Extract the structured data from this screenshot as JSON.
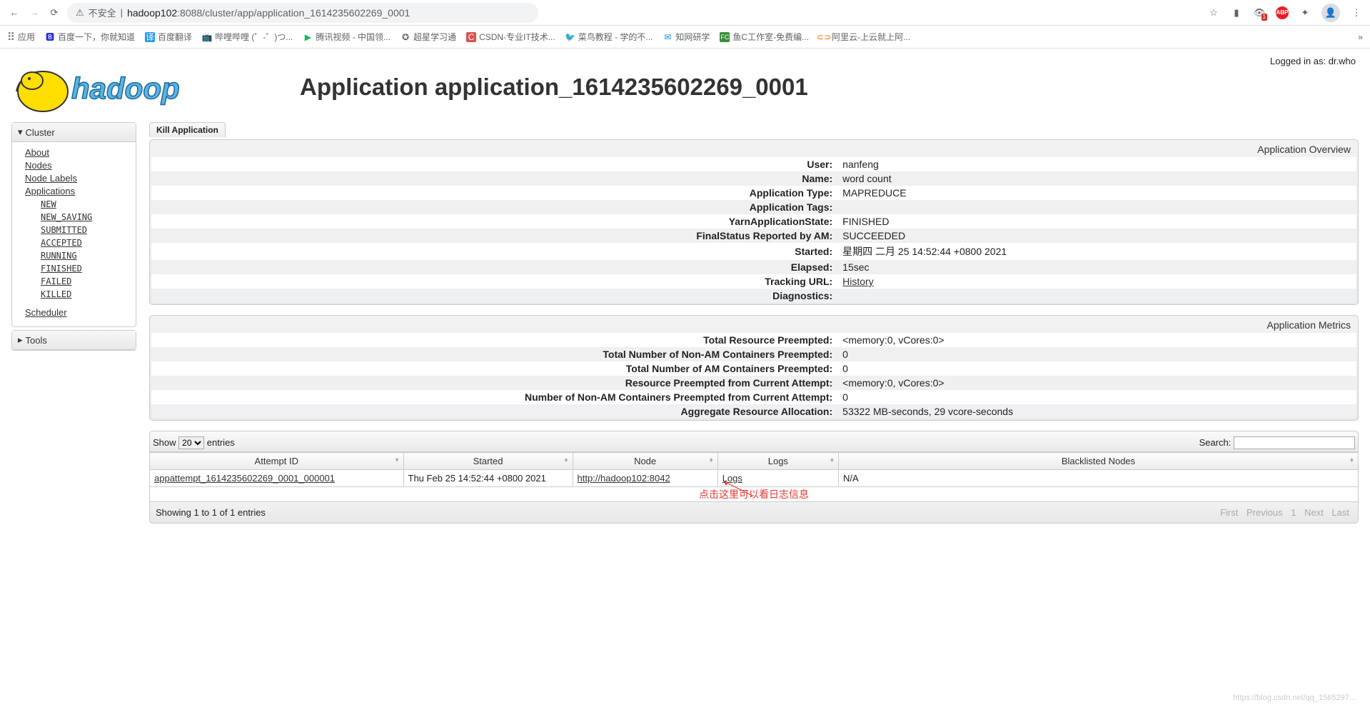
{
  "browser": {
    "url_security": "不安全",
    "url_display": "hadoop102:8088/cluster/app/application_1614235602269_0001",
    "bookmarks": [
      {
        "label": "应用",
        "icon": "⠿"
      },
      {
        "label": "百度一下，你就知道",
        "icon": "🅱"
      },
      {
        "label": "百度翻译",
        "icon": "译"
      },
      {
        "label": "哔哩哔哩 (゜-゜)つ...",
        "icon": "📺"
      },
      {
        "label": "腾讯视频 - 中国领...",
        "icon": "▶"
      },
      {
        "label": "超星学习通",
        "icon": "✪"
      },
      {
        "label": "CSDN-专业IT技术...",
        "icon": "C"
      },
      {
        "label": "菜鸟教程 - 学的不...",
        "icon": "🐦"
      },
      {
        "label": "知网研学",
        "icon": "✉"
      },
      {
        "label": "鱼C工作室-免费编...",
        "icon": "FC"
      },
      {
        "label": "阿里云-上云就上阿...",
        "icon": "⊂⊃"
      }
    ]
  },
  "header": {
    "logged_in": "Logged in as: dr.who",
    "title": "Application application_1614235602269_0001"
  },
  "sidebar": {
    "cluster_title": "Cluster",
    "tools_title": "Tools",
    "items": {
      "about": "About",
      "nodes": "Nodes",
      "node_labels": "Node Labels",
      "applications": "Applications",
      "scheduler": "Scheduler"
    },
    "states": [
      "NEW",
      "NEW_SAVING",
      "SUBMITTED",
      "ACCEPTED",
      "RUNNING",
      "FINISHED",
      "FAILED",
      "KILLED"
    ]
  },
  "actions": {
    "kill": "Kill Application"
  },
  "overview": {
    "section_title": "Application Overview",
    "rows": [
      {
        "k": "User:",
        "v": "nanfeng"
      },
      {
        "k": "Name:",
        "v": "word count"
      },
      {
        "k": "Application Type:",
        "v": "MAPREDUCE"
      },
      {
        "k": "Application Tags:",
        "v": ""
      },
      {
        "k": "YarnApplicationState:",
        "v": "FINISHED"
      },
      {
        "k": "FinalStatus Reported by AM:",
        "v": "SUCCEEDED"
      },
      {
        "k": "Started:",
        "v": "星期四 二月 25 14:52:44 +0800 2021"
      },
      {
        "k": "Elapsed:",
        "v": "15sec"
      },
      {
        "k": "Tracking URL:",
        "v": "History",
        "link": true
      },
      {
        "k": "Diagnostics:",
        "v": ""
      }
    ]
  },
  "metrics": {
    "section_title": "Application Metrics",
    "rows": [
      {
        "k": "Total Resource Preempted:",
        "v": "<memory:0, vCores:0>"
      },
      {
        "k": "Total Number of Non-AM Containers Preempted:",
        "v": "0"
      },
      {
        "k": "Total Number of AM Containers Preempted:",
        "v": "0"
      },
      {
        "k": "Resource Preempted from Current Attempt:",
        "v": "<memory:0, vCores:0>"
      },
      {
        "k": "Number of Non-AM Containers Preempted from Current Attempt:",
        "v": "0"
      },
      {
        "k": "Aggregate Resource Allocation:",
        "v": "53322 MB-seconds, 29 vcore-seconds"
      }
    ]
  },
  "table": {
    "show_label": "Show",
    "entries_label": "entries",
    "page_size": "20",
    "search_label": "Search:",
    "search_value": "",
    "headers": [
      "Attempt ID",
      "Started",
      "Node",
      "Logs",
      "Blacklisted Nodes"
    ],
    "row": {
      "attempt_id": "appattempt_1614235602269_0001_000001",
      "started": "Thu Feb 25 14:52:44 +0800 2021",
      "node": "http://hadoop102:8042",
      "logs": "Logs",
      "blacklisted": "N/A"
    },
    "info": "Showing 1 to 1 of 1 entries",
    "pager": {
      "first": "First",
      "prev": "Previous",
      "page": "1",
      "next": "Next",
      "last": "Last"
    }
  },
  "annotation": "点击这里可以看日志信息",
  "watermark": "https://blog.csdn.net/qq_1565297..."
}
